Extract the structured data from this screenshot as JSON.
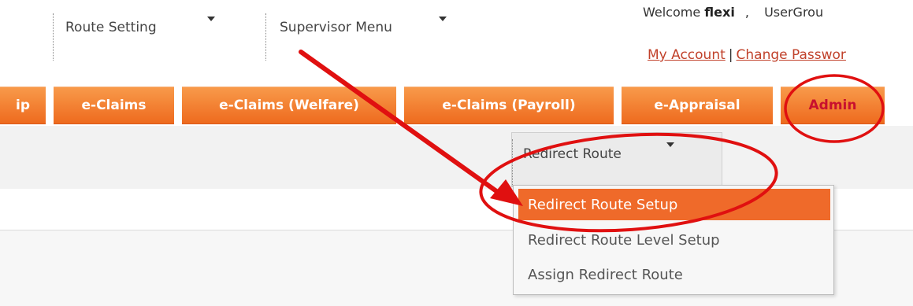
{
  "header": {
    "welcome_prefix": "Welcome",
    "username": "flexi",
    "comma": ",",
    "usergroup_text": "UserGrou",
    "my_account": "My Account",
    "link_separator": "|",
    "change_password": "Change Passwor"
  },
  "tabs": [
    {
      "label": "ip"
    },
    {
      "label": "e-Claims"
    },
    {
      "label": "e-Claims (Welfare)"
    },
    {
      "label": "e-Claims (Payroll)"
    },
    {
      "label": "e-Appraisal"
    },
    {
      "label": "Admin",
      "active": true
    }
  ],
  "submenu": [
    {
      "label": "Route Setting"
    },
    {
      "label": "Supervisor Menu"
    },
    {
      "label": "Redirect Route",
      "open": true
    }
  ],
  "dropdown": {
    "items": [
      {
        "label": "Redirect Route Setup",
        "highlighted": true
      },
      {
        "label": "Redirect Route Level Setup"
      },
      {
        "label": "Assign Redirect Route"
      }
    ]
  },
  "colors": {
    "tab_orange": "#ee6a1e",
    "active_tab_text": "#c8102e",
    "link": "#c1412a",
    "highlight": "#ef6a2a",
    "annotation_red": "#e01010"
  }
}
